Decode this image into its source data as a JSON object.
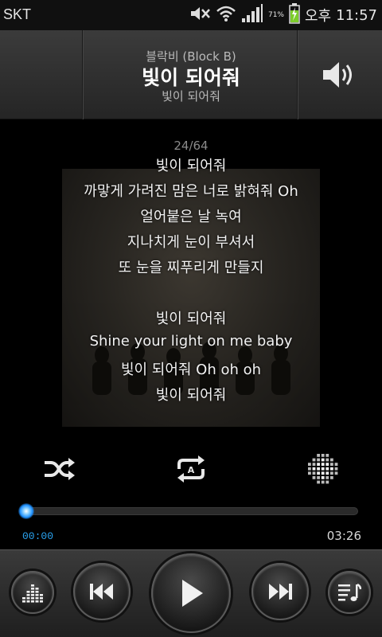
{
  "status_bar": {
    "carrier": "SKT",
    "battery_percent": "71%",
    "ampm": "오후",
    "time": "11:57",
    "icons": [
      "mute-icon",
      "wifi-icon",
      "signal-icon",
      "battery-charging-icon"
    ]
  },
  "header": {
    "artist": "블락비 (Block B)",
    "title": "빛이 되어줘",
    "album": "빛이 되어줘",
    "volume_icon": "speaker-icon"
  },
  "lyrics": {
    "track_index": "24/64",
    "lines": [
      "빛이 되어줘",
      "까맣게 가려진 맘은 너로 밝혀줘 Oh",
      "얼어붙은 날 녹여",
      "지나치게 눈이 부셔서",
      "또 눈을 찌푸리게 만들지",
      "",
      "빛이 되어줘",
      "Shine your light on me baby",
      "빛이 되어줘 Oh oh oh",
      "빛이 되어줘"
    ]
  },
  "options": {
    "shuffle_icon": "shuffle-icon",
    "repeat_icon": "repeat-all-icon",
    "repeat_badge": "A",
    "effect_icon": "sound-effect-icon"
  },
  "progress": {
    "elapsed": "00:00",
    "duration": "03:26",
    "fraction": 0.0,
    "accent": "#1e8fe8"
  },
  "controls": {
    "equalizer_icon": "equalizer-icon",
    "previous_icon": "previous-icon",
    "play_icon": "play-icon",
    "next_icon": "next-icon",
    "playlist_icon": "playlist-icon"
  }
}
